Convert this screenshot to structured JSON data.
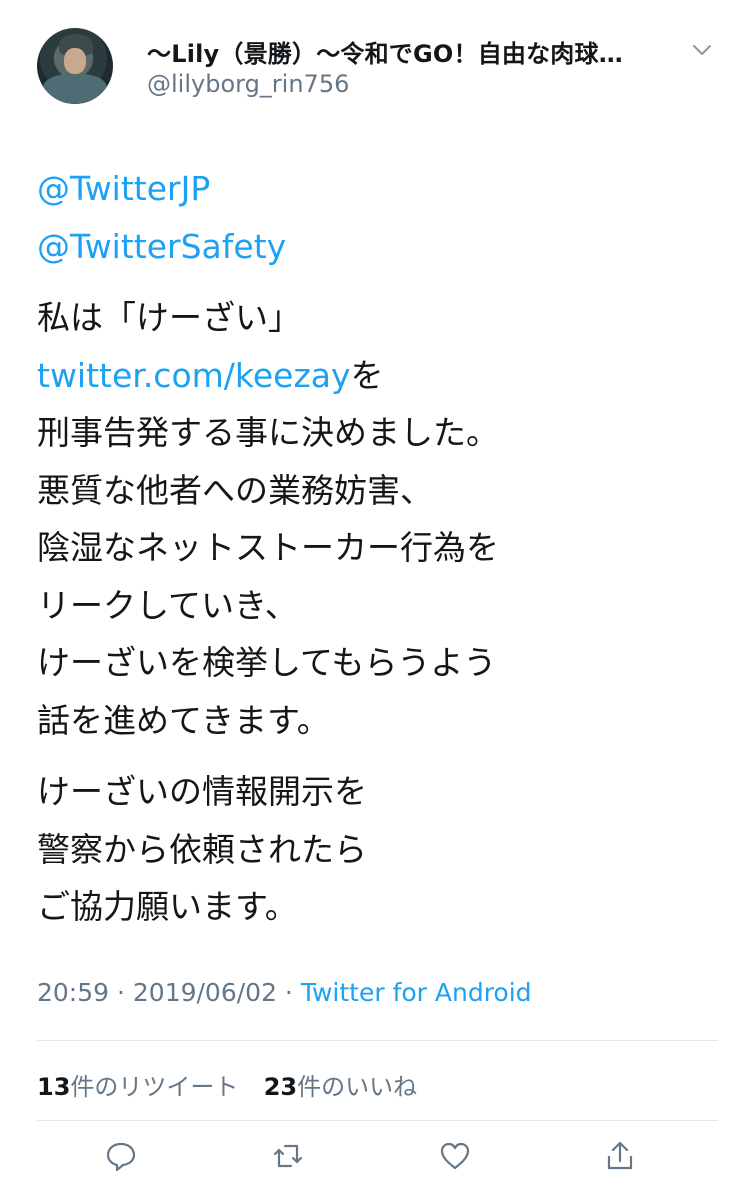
{
  "user": {
    "display_name": "〜Lily（景勝）〜令和でGO！自由な肉球…",
    "handle": "@lilyborg_rin756"
  },
  "tweet": {
    "mention_1": "@TwitterJP",
    "mention_2": "@TwitterSafety",
    "line_1": "私は「けーざい」",
    "link": "twitter.com/keezay",
    "link_suffix": "を",
    "line_3": "刑事告発する事に決めました。",
    "line_4": "悪質な他者への業務妨害、",
    "line_5": "陰湿なネットストーカー行為を",
    "line_6": "リークしていき、",
    "line_7": "けーざいを検挙してもらうよう",
    "line_8": "話を進めてきます。",
    "line_9": "けーざいの情報開示を",
    "line_10": "警察から依頼されたら",
    "line_11": "ご協力願います。"
  },
  "meta": {
    "time": "20:59",
    "separator": " · ",
    "date": "2019/06/02",
    "source": "Twitter for Android"
  },
  "stats": {
    "retweet_count": "13",
    "retweet_label": "件のリツイート",
    "like_count": "23",
    "like_label": "件のいいね"
  },
  "icons": {
    "menu": "chevron-down-icon",
    "reply": "reply-icon",
    "retweet": "retweet-icon",
    "like": "heart-icon",
    "share": "share-icon"
  },
  "colors": {
    "accent": "#1da1f2",
    "secondary_text": "#657786",
    "icon": "#657786"
  }
}
